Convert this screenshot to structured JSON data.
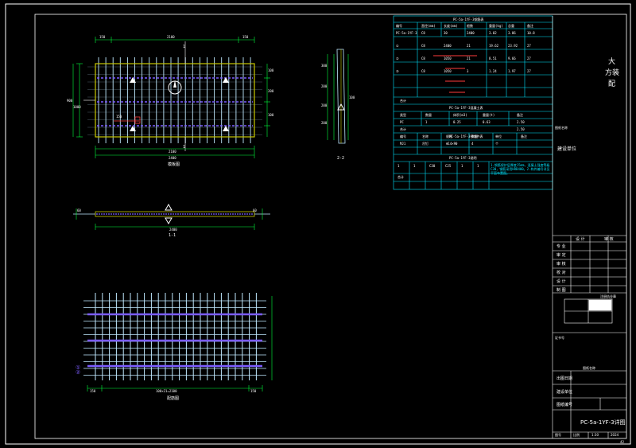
{
  "colors": {
    "background": "#000000",
    "frame": "#ffffff",
    "table": "#00e5ff",
    "dimension": "#00ff3c",
    "panel_edge": "#c8c800",
    "rebar": "#bfe9ff",
    "hidden": "#7b5cff",
    "section_line": "#ff3b3b"
  },
  "plan_view": {
    "top_dims": [
      "150",
      "2100",
      "150"
    ],
    "bottom_dims": [
      "2100",
      "2400"
    ],
    "left_dims": [
      "900",
      "1000"
    ],
    "right_dims": [
      "100",
      "200",
      "100"
    ],
    "section_mark_top": "1",
    "section_mark_bottom": "1",
    "callout": "150",
    "caption": "模板图"
  },
  "side_view": {
    "caption": "2-2",
    "dims": [
      "300",
      "200",
      "200",
      "200",
      "100"
    ]
  },
  "section_view": {
    "caption": "1-1",
    "dim_bottom": "2400",
    "dim_left": "60",
    "dim_right": "60"
  },
  "rebar_view": {
    "caption": "配筋图",
    "bottom_dims": [
      "150",
      "100×21=2100",
      "150"
    ],
    "markers": [
      "①",
      "②"
    ]
  },
  "table_rebar": {
    "title": "PC-5a-1YF-3钢筋表",
    "headers": [
      "编号",
      "直径(mm)",
      "长度(mm)",
      "根数",
      "重量(kg)",
      "总重",
      "备注"
    ],
    "rows": [
      [
        "PC-5a-1YF-3",
        "C8",
        "30",
        "2400",
        "3.02",
        "3.86",
        "10.8"
      ],
      [
        "①",
        "C8",
        "2400",
        "21",
        "19.62",
        "23.92",
        "27"
      ],
      [
        "②",
        "C8",
        "1050",
        "21",
        "8.51",
        "9.66",
        "27"
      ],
      [
        "③",
        "C8",
        "1050",
        "3",
        "1.24",
        "1.97",
        "27"
      ]
    ],
    "total_label": "合计"
  },
  "table_concrete": {
    "title": "PC-5a-1YF-3混凝土表",
    "headers": [
      "类型",
      "数量",
      "体积(m3)",
      "重量(t)",
      "备注"
    ],
    "rows": [
      [
        "PC",
        "1",
        "0.25",
        "0.63",
        "2.50"
      ],
      [
        "合计",
        "",
        "",
        "",
        "2.50"
      ]
    ]
  },
  "table_embed": {
    "title": "PC-5a-1YF-3预埋件表",
    "headers": [
      "编号",
      "名称",
      "规格",
      "数量",
      "单位",
      "备注"
    ],
    "rows": [
      [
        "MJ1",
        "吊钉",
        "Φ14×90",
        "4",
        "个",
        ""
      ]
    ]
  },
  "table_notes": {
    "title": "PC-5a-1YF-3说明",
    "rows": [
      [
        "1",
        "1",
        "C30",
        "C25",
        "1",
        "1"
      ],
      [
        "合计",
        "",
        "",
        "",
        "",
        ""
      ]
    ],
    "note": "1.钢筋保护层厚度15mm，混凝土强度等级C30，钢筋采用HRB400。2.构件编号详见平面布置图。"
  },
  "title_block": {
    "company_lines": [
      "大",
      "方装",
      "配"
    ],
    "project_label": "图纸名称",
    "project_name": "建设单位",
    "header_left": "设 计",
    "header_right": "审 核",
    "rows": [
      "专 业",
      "审 定",
      "审 核",
      "校 对",
      "设 计",
      "制 图"
    ],
    "stamp_label": "注册执业章",
    "cert_label": "证书号",
    "field_a": "图纸名称",
    "field_b": "出图日期",
    "field_c": "建设单位",
    "field_d": "图纸编号",
    "drawing_name": "PC-5a-1YF-3详图",
    "bottom_labels": [
      "比例",
      "1:30",
      "图号",
      "2024"
    ]
  },
  "sheet_number": "42"
}
